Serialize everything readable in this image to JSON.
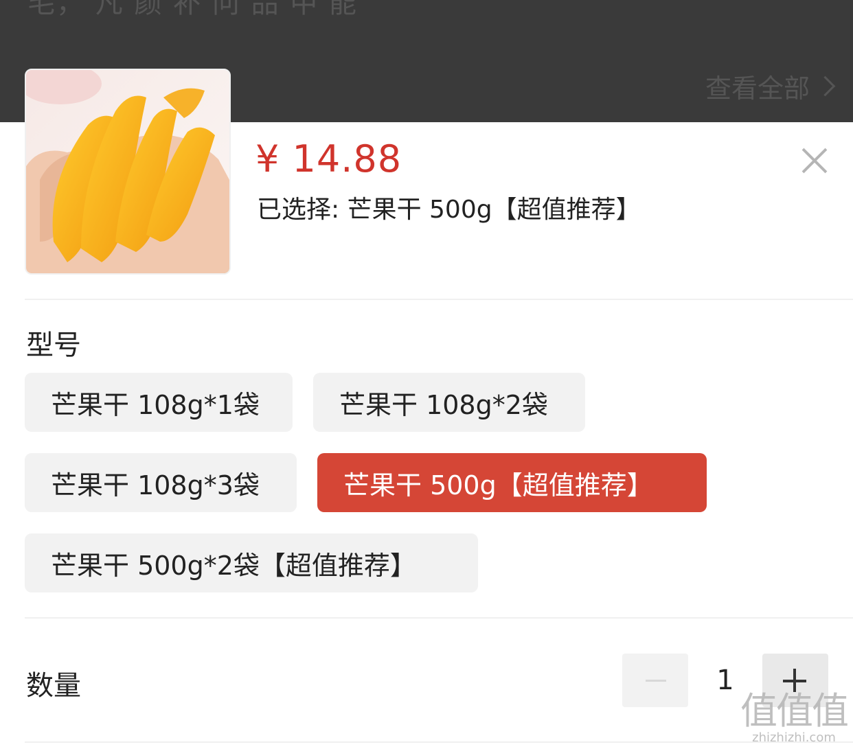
{
  "background": {
    "partial_title": "毛， 凡 颜 补 问 品 中 能",
    "view_all_label": "查看全部"
  },
  "sheet": {
    "price": "¥ 14.88",
    "selected_text": "已选择: 芒果干 500g【超值推荐】",
    "product_image": "dried-mango-in-hand",
    "accent_color": "#d54636"
  },
  "spec": {
    "title": "型号",
    "options": [
      {
        "label": "芒果干 108g*1袋",
        "selected": false
      },
      {
        "label": "芒果干 108g*2袋",
        "selected": false
      },
      {
        "label": "芒果干 108g*3袋",
        "selected": false
      },
      {
        "label": "芒果干 500g【超值推荐】",
        "selected": true
      },
      {
        "label": "芒果干 500g*2袋【超值推荐】",
        "selected": false
      }
    ]
  },
  "quantity": {
    "title": "数量",
    "value": "1"
  },
  "watermark": {
    "big": "值值值",
    "small": "zhizhizhi.com"
  }
}
